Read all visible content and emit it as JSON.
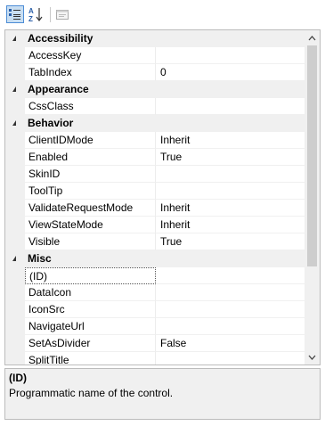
{
  "toolbar": {
    "buttons": [
      {
        "name": "categorized-button",
        "icon": "categorized-icon",
        "active": true
      },
      {
        "name": "alphabetical-button",
        "icon": "sort-az-icon",
        "active": false
      },
      {
        "name": "property-pages-button",
        "icon": "property-pages-icon",
        "active": false
      }
    ],
    "alpha_label": "AZ"
  },
  "grid": {
    "categories": [
      {
        "label": "Accessibility",
        "props": [
          {
            "name": "AccessKey",
            "value": ""
          },
          {
            "name": "TabIndex",
            "value": "0"
          }
        ]
      },
      {
        "label": "Appearance",
        "props": [
          {
            "name": "CssClass",
            "value": ""
          }
        ]
      },
      {
        "label": "Behavior",
        "props": [
          {
            "name": "ClientIDMode",
            "value": "Inherit"
          },
          {
            "name": "Enabled",
            "value": "True"
          },
          {
            "name": "SkinID",
            "value": ""
          },
          {
            "name": "ToolTip",
            "value": ""
          },
          {
            "name": "ValidateRequestMode",
            "value": "Inherit"
          },
          {
            "name": "ViewStateMode",
            "value": "Inherit"
          },
          {
            "name": "Visible",
            "value": "True"
          }
        ]
      },
      {
        "label": "Misc",
        "props": [
          {
            "name": "(ID)",
            "value": "",
            "selected": true
          },
          {
            "name": "DataIcon",
            "value": ""
          },
          {
            "name": "IconSrc",
            "value": ""
          },
          {
            "name": "NavigateUrl",
            "value": ""
          },
          {
            "name": "SetAsDivider",
            "value": "False"
          },
          {
            "name": "SplitTitle",
            "value": ""
          }
        ]
      }
    ]
  },
  "description": {
    "title": "(ID)",
    "text": "Programmatic name of the control."
  },
  "colors": {
    "accent": "#4d8dd6",
    "gutter": "#f0f0f0",
    "border": "#bcbcbc"
  }
}
